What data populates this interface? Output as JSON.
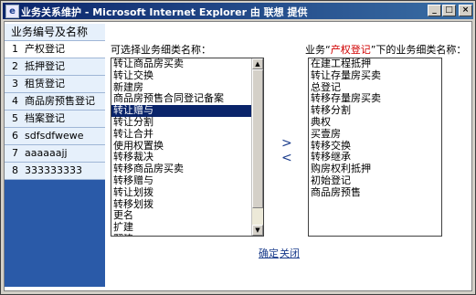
{
  "window": {
    "title": "业务关系维护 - Microsoft Internet Explorer 由 联想 提供",
    "minimize": "_",
    "maximize": "□",
    "close": "×"
  },
  "sidebar": {
    "header": "业务编号及名称",
    "items": [
      {
        "num": "1",
        "label": "产权登记"
      },
      {
        "num": "2",
        "label": "抵押登记"
      },
      {
        "num": "3",
        "label": "租赁登记"
      },
      {
        "num": "4",
        "label": "商品房预售登记"
      },
      {
        "num": "5",
        "label": "档案登记"
      },
      {
        "num": "6",
        "label": "sdfsdfwewe"
      },
      {
        "num": "7",
        "label": "aaaaaajj"
      },
      {
        "num": "8",
        "label": "333333333"
      }
    ]
  },
  "left_panel": {
    "label": "可选择业务细类名称：",
    "options": [
      "转让商品房买卖",
      "转让交换",
      "新建房",
      "商品房预售合同登记备案",
      "转让赠与",
      "转让分割",
      "转让合并",
      "使用权置换",
      "转移裁决",
      "转移商品房买卖",
      "转移赠与",
      "转让划拨",
      "转移划拨",
      "更名",
      "扩建",
      "翻建"
    ],
    "selected_index": 4
  },
  "right_panel": {
    "label_prefix": "业务“",
    "label_highlight": "产权登记",
    "label_suffix": "”下的业务细类名称：",
    "options": [
      "在建工程抵押",
      "转让存量房买卖",
      "总登记",
      "转移存量房买卖",
      "转移分割",
      "典权",
      "买壹房",
      "转移交换",
      "转移继承",
      "购房权利抵押",
      "初始登记",
      "商品房预售"
    ]
  },
  "buttons": {
    "move_right": ">",
    "move_left": "<",
    "confirm": "确定",
    "close": "关闭"
  },
  "icons": {
    "window_icon": "ie-page-icon"
  }
}
